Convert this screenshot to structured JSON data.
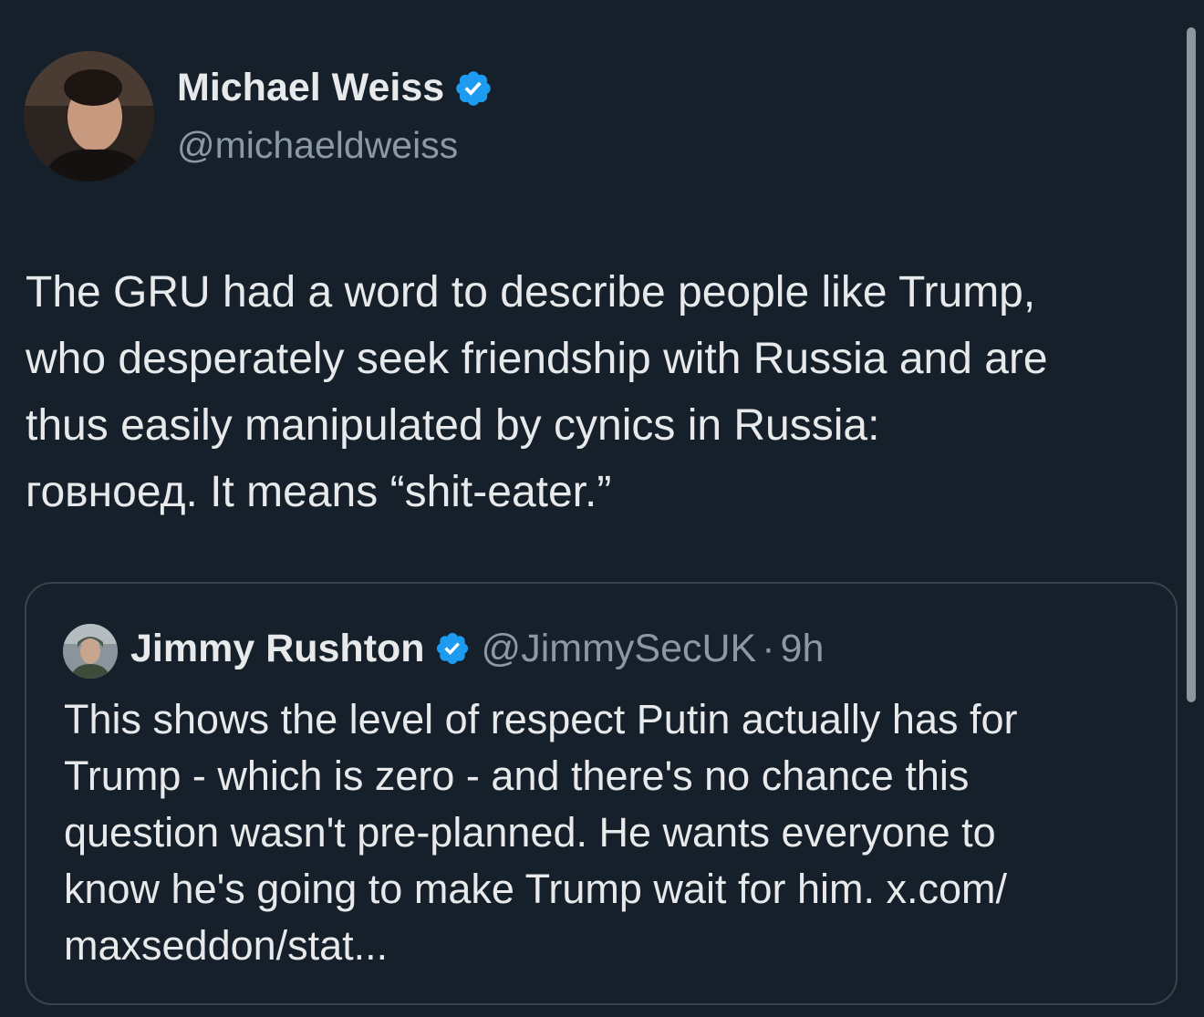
{
  "tweet": {
    "author_name": "Michael Weiss",
    "author_handle": "@michaeldweiss",
    "text": "The GRU had a word to describe people like Trump,\nwho desperately seek friendship with Russia and are\nthus easily manipulated by cynics in Russia:\nговноед. It means “shit-eater.”",
    "verified_icon": "verified-badge-icon"
  },
  "quote": {
    "author_name": "Jimmy Rushton",
    "author_handle": "@JimmySecUK",
    "separator": "·",
    "time": "9h",
    "text": "This shows the level of respect Putin actually has for\nTrump - which is zero - and there's no chance this\nquestion wasn't pre-planned. He wants everyone to\nknow he's going to make Trump wait for him. x.com/\nmaxseddon/stat..."
  },
  "colors": {
    "background": "#15202b",
    "text_primary": "#e7e9ea",
    "text_secondary": "#8b98a5",
    "verified_blue": "#1d9bf0",
    "border": "#38444d"
  }
}
